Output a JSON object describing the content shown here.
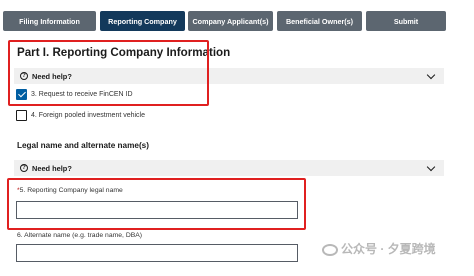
{
  "tabs": [
    {
      "label": "Filing Information",
      "active": false
    },
    {
      "label": "Reporting Company",
      "active": true
    },
    {
      "label": "Company Applicant(s)",
      "active": false
    },
    {
      "label": "Beneficial Owner(s)",
      "active": false
    },
    {
      "label": "Submit",
      "active": false
    }
  ],
  "section_title": "Part I. Reporting Company Information",
  "help_label": "Need help?",
  "help_icon": "?",
  "checkbox_fincen": {
    "label": "3. Request to receive FinCEN ID",
    "checked": true
  },
  "checkbox_foreign": {
    "label": "4. Foreign pooled investment vehicle",
    "checked": false
  },
  "legal_name_heading": "Legal name and alternate name(s)",
  "legal_name_field": {
    "required_marker": "*",
    "label": "5. Reporting Company legal name",
    "value": ""
  },
  "alternate_name_field": {
    "label": "6. Alternate name (e.g. trade name, DBA)",
    "value": ""
  },
  "watermark": {
    "text": "公众号 · 夕夏跨境"
  },
  "colors": {
    "active_tab": "#13395b",
    "inactive_tab": "#5c6670",
    "highlight": "#e02020",
    "checkbox_checked": "#005ea2"
  }
}
